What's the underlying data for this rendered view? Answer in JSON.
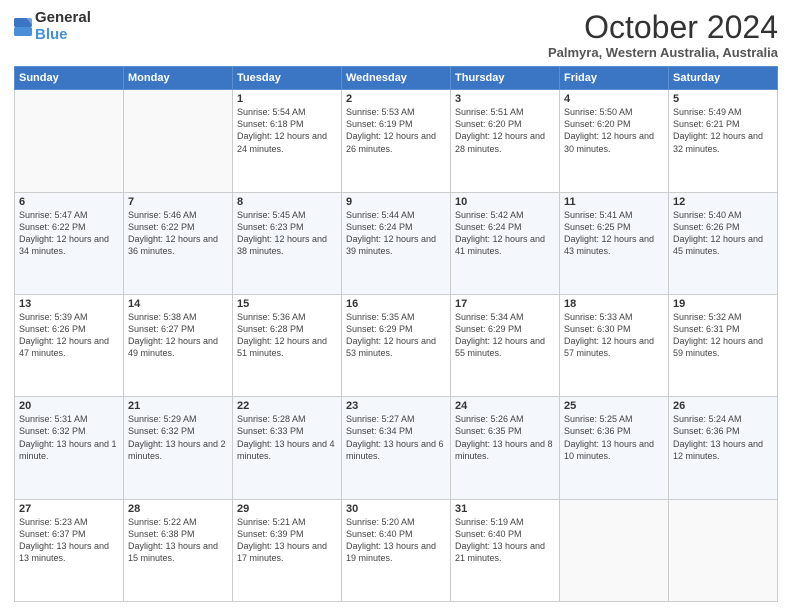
{
  "header": {
    "logo_general": "General",
    "logo_blue": "Blue",
    "month_title": "October 2024",
    "location": "Palmyra, Western Australia, Australia"
  },
  "days_of_week": [
    "Sunday",
    "Monday",
    "Tuesday",
    "Wednesday",
    "Thursday",
    "Friday",
    "Saturday"
  ],
  "weeks": [
    [
      {
        "day": "",
        "info": ""
      },
      {
        "day": "",
        "info": ""
      },
      {
        "day": "1",
        "info": "Sunrise: 5:54 AM\nSunset: 6:18 PM\nDaylight: 12 hours and 24 minutes."
      },
      {
        "day": "2",
        "info": "Sunrise: 5:53 AM\nSunset: 6:19 PM\nDaylight: 12 hours and 26 minutes."
      },
      {
        "day": "3",
        "info": "Sunrise: 5:51 AM\nSunset: 6:20 PM\nDaylight: 12 hours and 28 minutes."
      },
      {
        "day": "4",
        "info": "Sunrise: 5:50 AM\nSunset: 6:20 PM\nDaylight: 12 hours and 30 minutes."
      },
      {
        "day": "5",
        "info": "Sunrise: 5:49 AM\nSunset: 6:21 PM\nDaylight: 12 hours and 32 minutes."
      }
    ],
    [
      {
        "day": "6",
        "info": "Sunrise: 5:47 AM\nSunset: 6:22 PM\nDaylight: 12 hours and 34 minutes."
      },
      {
        "day": "7",
        "info": "Sunrise: 5:46 AM\nSunset: 6:22 PM\nDaylight: 12 hours and 36 minutes."
      },
      {
        "day": "8",
        "info": "Sunrise: 5:45 AM\nSunset: 6:23 PM\nDaylight: 12 hours and 38 minutes."
      },
      {
        "day": "9",
        "info": "Sunrise: 5:44 AM\nSunset: 6:24 PM\nDaylight: 12 hours and 39 minutes."
      },
      {
        "day": "10",
        "info": "Sunrise: 5:42 AM\nSunset: 6:24 PM\nDaylight: 12 hours and 41 minutes."
      },
      {
        "day": "11",
        "info": "Sunrise: 5:41 AM\nSunset: 6:25 PM\nDaylight: 12 hours and 43 minutes."
      },
      {
        "day": "12",
        "info": "Sunrise: 5:40 AM\nSunset: 6:26 PM\nDaylight: 12 hours and 45 minutes."
      }
    ],
    [
      {
        "day": "13",
        "info": "Sunrise: 5:39 AM\nSunset: 6:26 PM\nDaylight: 12 hours and 47 minutes."
      },
      {
        "day": "14",
        "info": "Sunrise: 5:38 AM\nSunset: 6:27 PM\nDaylight: 12 hours and 49 minutes."
      },
      {
        "day": "15",
        "info": "Sunrise: 5:36 AM\nSunset: 6:28 PM\nDaylight: 12 hours and 51 minutes."
      },
      {
        "day": "16",
        "info": "Sunrise: 5:35 AM\nSunset: 6:29 PM\nDaylight: 12 hours and 53 minutes."
      },
      {
        "day": "17",
        "info": "Sunrise: 5:34 AM\nSunset: 6:29 PM\nDaylight: 12 hours and 55 minutes."
      },
      {
        "day": "18",
        "info": "Sunrise: 5:33 AM\nSunset: 6:30 PM\nDaylight: 12 hours and 57 minutes."
      },
      {
        "day": "19",
        "info": "Sunrise: 5:32 AM\nSunset: 6:31 PM\nDaylight: 12 hours and 59 minutes."
      }
    ],
    [
      {
        "day": "20",
        "info": "Sunrise: 5:31 AM\nSunset: 6:32 PM\nDaylight: 13 hours and 1 minute."
      },
      {
        "day": "21",
        "info": "Sunrise: 5:29 AM\nSunset: 6:32 PM\nDaylight: 13 hours and 2 minutes."
      },
      {
        "day": "22",
        "info": "Sunrise: 5:28 AM\nSunset: 6:33 PM\nDaylight: 13 hours and 4 minutes."
      },
      {
        "day": "23",
        "info": "Sunrise: 5:27 AM\nSunset: 6:34 PM\nDaylight: 13 hours and 6 minutes."
      },
      {
        "day": "24",
        "info": "Sunrise: 5:26 AM\nSunset: 6:35 PM\nDaylight: 13 hours and 8 minutes."
      },
      {
        "day": "25",
        "info": "Sunrise: 5:25 AM\nSunset: 6:36 PM\nDaylight: 13 hours and 10 minutes."
      },
      {
        "day": "26",
        "info": "Sunrise: 5:24 AM\nSunset: 6:36 PM\nDaylight: 13 hours and 12 minutes."
      }
    ],
    [
      {
        "day": "27",
        "info": "Sunrise: 5:23 AM\nSunset: 6:37 PM\nDaylight: 13 hours and 13 minutes."
      },
      {
        "day": "28",
        "info": "Sunrise: 5:22 AM\nSunset: 6:38 PM\nDaylight: 13 hours and 15 minutes."
      },
      {
        "day": "29",
        "info": "Sunrise: 5:21 AM\nSunset: 6:39 PM\nDaylight: 13 hours and 17 minutes."
      },
      {
        "day": "30",
        "info": "Sunrise: 5:20 AM\nSunset: 6:40 PM\nDaylight: 13 hours and 19 minutes."
      },
      {
        "day": "31",
        "info": "Sunrise: 5:19 AM\nSunset: 6:40 PM\nDaylight: 13 hours and 21 minutes."
      },
      {
        "day": "",
        "info": ""
      },
      {
        "day": "",
        "info": ""
      }
    ]
  ]
}
